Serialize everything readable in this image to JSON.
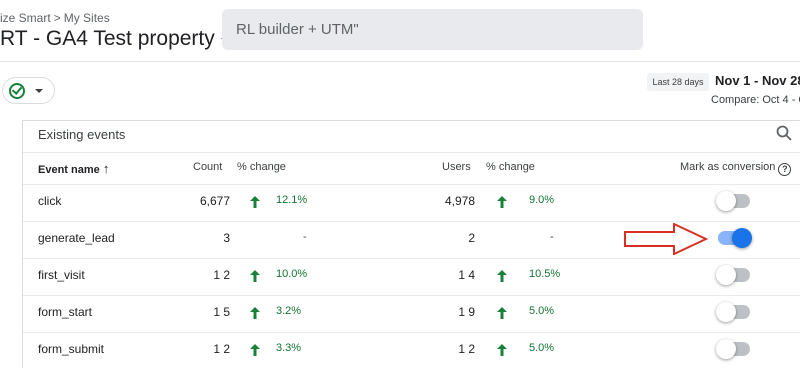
{
  "header": {
    "breadcrumb": [
      "ize Smart",
      "My Sites"
    ],
    "breadcrumb_sep": ">",
    "property": "RT - GA4 Test property",
    "search_query": "RL builder + UTM\""
  },
  "date": {
    "chip": "Last 28 days",
    "range": "Nov 1 - Nov 28",
    "compare": "Compare: Oct 4 - O"
  },
  "card": {
    "title": "Existing events",
    "columns": {
      "event_name": "Event name",
      "sort_arrow": "↑",
      "count": "Count",
      "count_change": "% change",
      "users": "Users",
      "users_change": "% change",
      "mark": "Mark as conversion",
      "help": "?"
    },
    "rows": [
      {
        "name": "click",
        "count": "6,677",
        "count_change": "12.1%",
        "count_up": true,
        "users": "4,978",
        "users_change": "9.0%",
        "users_up": true,
        "conversion": false
      },
      {
        "name": "generate_lead",
        "count": "3",
        "count_change": "-",
        "count_up": false,
        "users": "2",
        "users_change": "-",
        "users_up": false,
        "conversion": true
      },
      {
        "name": "first_visit",
        "count": "1          2",
        "count_change": "10.0%",
        "count_up": true,
        "users": "1          4",
        "users_change": "10.5%",
        "users_up": true,
        "conversion": false
      },
      {
        "name": "form_start",
        "count": "1          5",
        "count_change": "3.2%",
        "count_up": true,
        "users": "1          9",
        "users_change": "5.0%",
        "users_up": true,
        "conversion": false
      },
      {
        "name": "form_submit",
        "count": "1          2",
        "count_change": "3.3%",
        "count_up": true,
        "users": "1          2",
        "users_change": "5.0%",
        "users_up": true,
        "conversion": false
      }
    ]
  },
  "colors": {
    "accent": "#1a73e8",
    "positive": "#137333",
    "arrow_annotation": "#d93025"
  }
}
